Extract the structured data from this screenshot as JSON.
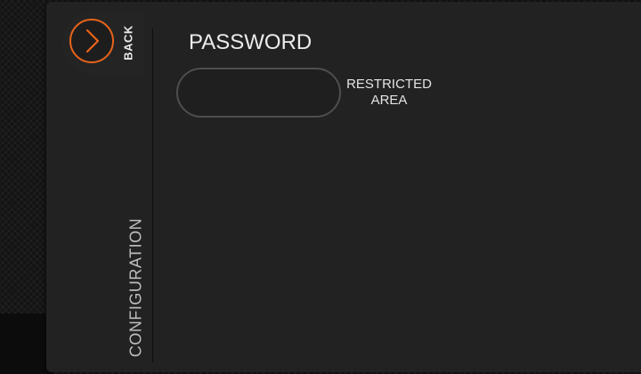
{
  "nav": {
    "back_label": "BACK",
    "back_icon": "chevron-right-icon",
    "section_label": "CONFIGURATION"
  },
  "form": {
    "title": "PASSWORD",
    "password_value": "",
    "password_placeholder": ""
  },
  "notice": {
    "line1": "RESTRICTED",
    "line2": "AREA"
  },
  "colors": {
    "accent": "#e8631a",
    "panel": "#222222",
    "text": "#ececec"
  }
}
